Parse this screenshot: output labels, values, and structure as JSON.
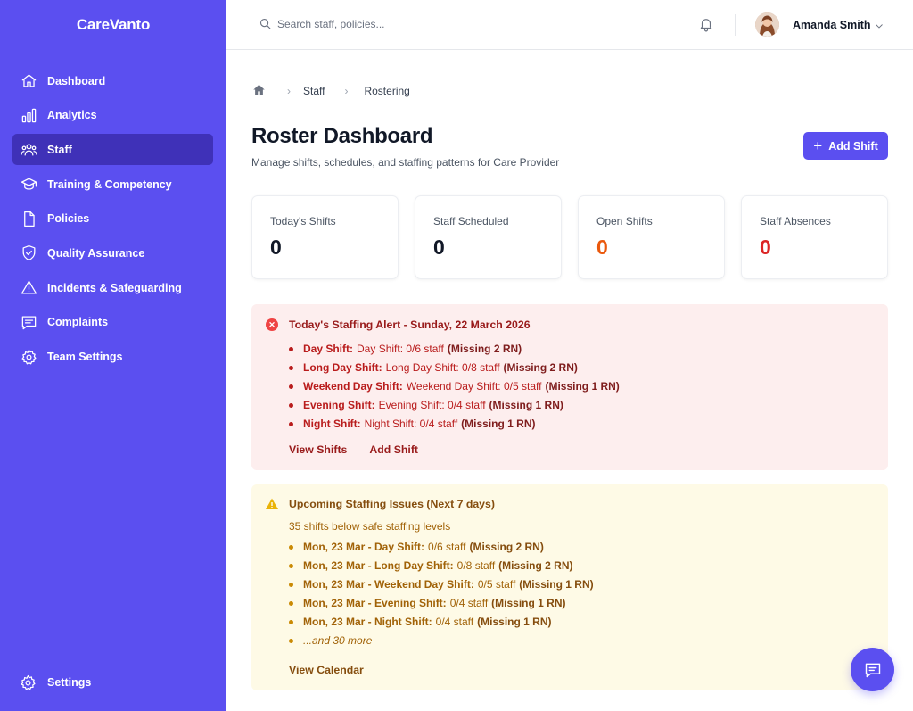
{
  "app": {
    "brand": "CareVanto"
  },
  "sidebar": {
    "items": [
      {
        "label": "Dashboard",
        "icon": "home-icon",
        "active": false
      },
      {
        "label": "Analytics",
        "icon": "bar-chart-icon",
        "active": false
      },
      {
        "label": "Staff",
        "icon": "users-icon",
        "active": true
      },
      {
        "label": "Training & Competency",
        "icon": "graduation-cap-icon",
        "active": false
      },
      {
        "label": "Policies",
        "icon": "document-icon",
        "active": false
      },
      {
        "label": "Quality Assurance",
        "icon": "shield-check-icon",
        "active": false
      },
      {
        "label": "Incidents & Safeguarding",
        "icon": "warning-triangle-icon",
        "active": false
      },
      {
        "label": "Complaints",
        "icon": "message-icon",
        "active": false
      },
      {
        "label": "Team Settings",
        "icon": "gear-icon",
        "active": false
      }
    ],
    "settings_label": "Settings"
  },
  "topbar": {
    "search_placeholder": "Search staff, policies...",
    "user_name": "Amanda Smith"
  },
  "breadcrumb": {
    "items": [
      "Staff",
      "Rostering"
    ]
  },
  "header": {
    "title": "Roster Dashboard",
    "subtitle": "Manage shifts, schedules, and staffing patterns for Care Provider",
    "add_shift_label": "Add Shift"
  },
  "stats": [
    {
      "label": "Today's Shifts",
      "value": "0",
      "color": "#111827"
    },
    {
      "label": "Staff Scheduled",
      "value": "0",
      "color": "#111827"
    },
    {
      "label": "Open Shifts",
      "value": "0",
      "color": "#ea580c"
    },
    {
      "label": "Staff Absences",
      "value": "0",
      "color": "#dc2626"
    }
  ],
  "alert": {
    "title": "Today's Staffing Alert - Sunday, 22 March 2026",
    "items": [
      {
        "name": "Day Shift:",
        "detail": "Day Shift: 0/6 staff",
        "missing": "(Missing 2 RN)"
      },
      {
        "name": "Long Day Shift:",
        "detail": "Long Day Shift: 0/8 staff",
        "missing": "(Missing 2 RN)"
      },
      {
        "name": "Weekend Day Shift:",
        "detail": "Weekend Day Shift: 0/5 staff",
        "missing": "(Missing 1 RN)"
      },
      {
        "name": "Evening Shift:",
        "detail": "Evening Shift: 0/4 staff",
        "missing": "(Missing 1 RN)"
      },
      {
        "name": "Night Shift:",
        "detail": "Night Shift: 0/4 staff",
        "missing": "(Missing 1 RN)"
      }
    ],
    "view_shifts_label": "View Shifts",
    "add_shift_label": "Add Shift"
  },
  "upcoming": {
    "title": "Upcoming Staffing Issues (Next 7 days)",
    "subtitle": "35 shifts below safe staffing levels",
    "items": [
      {
        "name": "Mon, 23 Mar - Day Shift:",
        "detail": "0/6 staff",
        "missing": "(Missing 2 RN)"
      },
      {
        "name": "Mon, 23 Mar - Long Day Shift:",
        "detail": "0/8 staff",
        "missing": "(Missing 2 RN)"
      },
      {
        "name": "Mon, 23 Mar - Weekend Day Shift:",
        "detail": "0/5 staff",
        "missing": "(Missing 1 RN)"
      },
      {
        "name": "Mon, 23 Mar - Evening Shift:",
        "detail": "0/4 staff",
        "missing": "(Missing 1 RN)"
      },
      {
        "name": "Mon, 23 Mar - Night Shift:",
        "detail": "0/4 staff",
        "missing": "(Missing 1 RN)"
      }
    ],
    "more_label": "...and 30 more",
    "view_calendar_label": "View Calendar"
  }
}
